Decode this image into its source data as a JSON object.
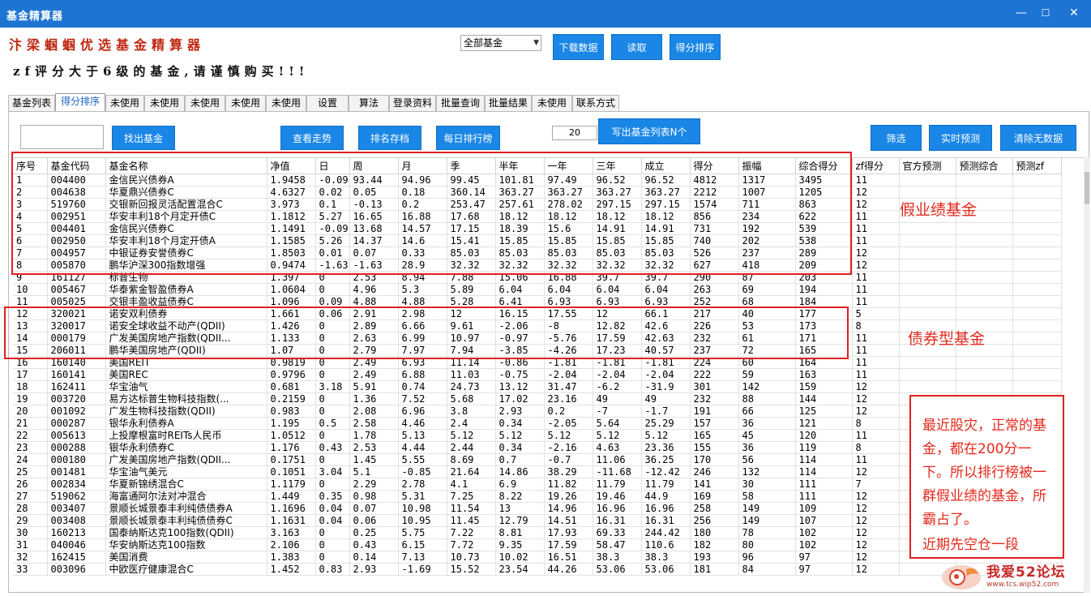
{
  "window": {
    "title": "基金精算器",
    "minimize": "—",
    "maximize": "☐",
    "close": "✕"
  },
  "header": {
    "app_name": "汴梁蝈蝈优选基金精算器",
    "warning": "zf评分大于6级的基金,请谨慎购买!!!",
    "fund_filter": "全部基金",
    "download_button": "下载数据",
    "read_button": "读取",
    "score_sort_button": "得分排序"
  },
  "tabs": [
    "基金列表",
    "得分排序",
    "未使用",
    "未使用",
    "未使用",
    "未使用",
    "未使用",
    "设置",
    "算法",
    "登录资料",
    "批量查询",
    "批量结果",
    "未使用",
    "联系方式"
  ],
  "active_tab": "得分排序",
  "toolbar": {
    "find_fund": "找出基金",
    "view_trend": "查看走势",
    "rank_archive": "排名存档",
    "daily_rank": "每日排行榜",
    "count_value": "20",
    "write_list": "写出基金列表N个",
    "filter": "筛选",
    "realtime_predict": "实时预测",
    "clear_invalid": "清除无数据"
  },
  "table": {
    "columns": [
      "序号",
      "基金代码",
      "基金名称",
      "净值",
      "日",
      "周",
      "月",
      "季",
      "半年",
      "一年",
      "三年",
      "成立",
      "得分",
      "振幅",
      "综合得分",
      "zf得分",
      "官方预测",
      "预测综合",
      "预测zf"
    ],
    "rows": [
      [
        "1",
        "004400",
        "金信民兴债券A",
        "1.9458",
        "-0.09",
        "93.44",
        "94.96",
        "99.45",
        "101.81",
        "97.49",
        "96.52",
        "96.52",
        "4812",
        "1317",
        "3495",
        "11"
      ],
      [
        "2",
        "004638",
        "华夏鼎兴债券C",
        "4.6327",
        "0.02",
        "0.05",
        "0.18",
        "360.14",
        "363.27",
        "363.27",
        "363.27",
        "363.27",
        "2212",
        "1007",
        "1205",
        "12"
      ],
      [
        "3",
        "519760",
        "交银新回报灵活配置混合C",
        "3.973",
        "0.1",
        "-0.13",
        "0.2",
        "253.47",
        "257.61",
        "278.02",
        "297.15",
        "297.15",
        "1574",
        "711",
        "863",
        "12"
      ],
      [
        "4",
        "002951",
        "华安丰利18个月定开债C",
        "1.1812",
        "5.27",
        "16.65",
        "16.88",
        "17.68",
        "18.12",
        "18.12",
        "18.12",
        "18.12",
        "856",
        "234",
        "622",
        "11"
      ],
      [
        "5",
        "004401",
        "金信民兴债券C",
        "1.1491",
        "-0.09",
        "13.68",
        "14.57",
        "17.15",
        "18.39",
        "15.6",
        "14.91",
        "14.91",
        "731",
        "192",
        "539",
        "11"
      ],
      [
        "6",
        "002950",
        "华安丰利18个月定开债A",
        "1.1585",
        "5.26",
        "14.37",
        "14.6",
        "15.41",
        "15.85",
        "15.85",
        "15.85",
        "15.85",
        "740",
        "202",
        "538",
        "11"
      ],
      [
        "7",
        "004957",
        "中银证券安誉债券C",
        "1.8503",
        "0.01",
        "0.07",
        "0.33",
        "85.03",
        "85.03",
        "85.03",
        "85.03",
        "85.03",
        "526",
        "237",
        "289",
        "12"
      ],
      [
        "8",
        "005870",
        "鹏华沪深300指数增强",
        "0.9474",
        "-1.63",
        "-1.63",
        "28.9",
        "32.32",
        "32.32",
        "32.32",
        "32.32",
        "32.32",
        "627",
        "418",
        "209",
        "12"
      ],
      [
        "9",
        "161127",
        "标普生物",
        "1.397",
        "0",
        "2.53",
        "8.94",
        "7.88",
        "15.06",
        "16.88",
        "39.7",
        "39.7",
        "290",
        "87",
        "203",
        "11"
      ],
      [
        "10",
        "005467",
        "华泰紫金智盈债券A",
        "1.0604",
        "0",
        "4.96",
        "5.3",
        "5.89",
        "6.04",
        "6.04",
        "6.04",
        "6.04",
        "263",
        "69",
        "194",
        "11"
      ],
      [
        "11",
        "005025",
        "交银丰盈收益债券C",
        "1.096",
        "0.09",
        "4.88",
        "4.88",
        "5.28",
        "6.41",
        "6.93",
        "6.93",
        "6.93",
        "252",
        "68",
        "184",
        "11"
      ],
      [
        "12",
        "320021",
        "诺安双利债券",
        "1.661",
        "0.06",
        "2.91",
        "2.98",
        "12",
        "16.15",
        "17.55",
        "12",
        "66.1",
        "217",
        "40",
        "177",
        "5"
      ],
      [
        "13",
        "320017",
        "诺安全球收益不动产(QDII)",
        "1.426",
        "0",
        "2.89",
        "6.66",
        "9.61",
        "-2.06",
        "-8",
        "12.82",
        "42.6",
        "226",
        "53",
        "173",
        "8"
      ],
      [
        "14",
        "000179",
        "广发美国房地产指数(QDII...",
        "1.133",
        "0",
        "2.63",
        "6.99",
        "10.97",
        "-0.97",
        "-5.76",
        "17.59",
        "42.63",
        "232",
        "61",
        "171",
        "11"
      ],
      [
        "15",
        "206011",
        "鹏华美国房地产(QDII)",
        "1.07",
        "0",
        "2.79",
        "7.97",
        "7.94",
        "-3.85",
        "-4.26",
        "17.23",
        "40.57",
        "237",
        "72",
        "165",
        "11"
      ],
      [
        "16",
        "160140",
        "美国REIT",
        "0.9819",
        "0",
        "2.49",
        "6.93",
        "11.14",
        "-0.86",
        "-1.81",
        "-1.81",
        "-1.81",
        "224",
        "60",
        "164",
        "11"
      ],
      [
        "17",
        "160141",
        "美国REC",
        "0.9796",
        "0",
        "2.49",
        "6.88",
        "11.03",
        "-0.75",
        "-2.04",
        "-2.04",
        "-2.04",
        "222",
        "59",
        "163",
        "11"
      ],
      [
        "18",
        "162411",
        "华宝油气",
        "0.681",
        "3.18",
        "5.91",
        "0.74",
        "24.73",
        "13.12",
        "31.47",
        "-6.2",
        "-31.9",
        "301",
        "142",
        "159",
        "12"
      ],
      [
        "19",
        "003720",
        "易方达标普生物科技指数(...",
        "0.2159",
        "0",
        "1.36",
        "7.52",
        "5.68",
        "17.02",
        "23.16",
        "49",
        "49",
        "232",
        "88",
        "144",
        "12"
      ],
      [
        "20",
        "001092",
        "广发生物科技指数(QDII)",
        "0.983",
        "0",
        "2.08",
        "6.96",
        "3.8",
        "2.93",
        "0.2",
        "-7",
        "-1.7",
        "191",
        "66",
        "125",
        "12"
      ],
      [
        "21",
        "000287",
        "银华永利债券A",
        "1.195",
        "0.5",
        "2.58",
        "4.46",
        "2.4",
        "0.34",
        "-2.05",
        "5.64",
        "25.29",
        "157",
        "36",
        "121",
        "8"
      ],
      [
        "22",
        "005613",
        "上投摩根富时REITs人民币",
        "1.0512",
        "0",
        "1.78",
        "5.13",
        "5.12",
        "5.12",
        "5.12",
        "5.12",
        "5.12",
        "165",
        "45",
        "120",
        "11"
      ],
      [
        "23",
        "000288",
        "银华永利债券C",
        "1.176",
        "0.43",
        "2.53",
        "4.44",
        "2.44",
        "0.34",
        "-2.16",
        "4.63",
        "23.36",
        "155",
        "36",
        "119",
        "8"
      ],
      [
        "24",
        "000180",
        "广发美国房地产指数(QDII...",
        "0.1751",
        "0",
        "1.45",
        "5.55",
        "8.69",
        "0.7",
        "-0.7",
        "11.06",
        "36.25",
        "170",
        "56",
        "114",
        "11"
      ],
      [
        "25",
        "001481",
        "华宝油气美元",
        "0.1051",
        "3.04",
        "5.1",
        "-0.85",
        "21.64",
        "14.86",
        "38.29",
        "-11.68",
        "-12.42",
        "246",
        "132",
        "114",
        "12"
      ],
      [
        "26",
        "002834",
        "华夏新锦绣混合C",
        "1.1179",
        "0",
        "2.29",
        "2.78",
        "4.1",
        "6.9",
        "11.82",
        "11.79",
        "11.79",
        "141",
        "30",
        "111",
        "7"
      ],
      [
        "27",
        "519062",
        "海富通阿尔法对冲混合",
        "1.449",
        "0.35",
        "0.98",
        "5.31",
        "7.25",
        "8.22",
        "19.26",
        "19.46",
        "44.9",
        "169",
        "58",
        "111",
        "12"
      ],
      [
        "28",
        "003407",
        "景顺长城景泰丰利纯债债券A",
        "1.1696",
        "0.04",
        "0.07",
        "10.98",
        "11.54",
        "13",
        "14.96",
        "16.96",
        "16.96",
        "258",
        "149",
        "109",
        "12"
      ],
      [
        "29",
        "003408",
        "景顺长城景泰丰利纯债债券C",
        "1.1631",
        "0.04",
        "0.06",
        "10.95",
        "11.45",
        "12.79",
        "14.51",
        "16.31",
        "16.31",
        "256",
        "149",
        "107",
        "12"
      ],
      [
        "30",
        "160213",
        "国泰纳斯达克100指数(QDII)",
        "3.163",
        "0",
        "0.25",
        "5.75",
        "7.22",
        "8.81",
        "17.93",
        "69.33",
        "244.42",
        "180",
        "78",
        "102",
        "12"
      ],
      [
        "31",
        "040046",
        "华安纳斯达克100指数",
        "2.106",
        "0",
        "0.43",
        "6.15",
        "7.72",
        "9.35",
        "17.59",
        "58.47",
        "110.6",
        "182",
        "80",
        "102",
        "12"
      ],
      [
        "32",
        "162415",
        "美国消费",
        "1.383",
        "0",
        "0.14",
        "7.13",
        "10.73",
        "10.02",
        "16.51",
        "38.3",
        "38.3",
        "193",
        "96",
        "97",
        "12"
      ],
      [
        "33",
        "003096",
        "中欧医疗健康混合C",
        "1.452",
        "0.83",
        "2.93",
        "-1.69",
        "15.52",
        "23.54",
        "44.26",
        "53.06",
        "53.06",
        "181",
        "84",
        "97",
        "12"
      ]
    ]
  },
  "annotations": {
    "fake_label": "假业绩基金",
    "bond_label": "债券型基金",
    "note_text": "最近股灾，正常的基金，都在200分一下。所以排行榜被一群假业绩的基金，所霸占了。",
    "note_text2": "近期先空仓一段"
  },
  "watermark": {
    "text": "我爱52论坛",
    "url": "www.tcs.wip52.com"
  },
  "colors": {
    "titlebar": "#1e74d2",
    "button": "#1a86e6",
    "annotation": "#e4291d",
    "heading": "#c0260f"
  }
}
